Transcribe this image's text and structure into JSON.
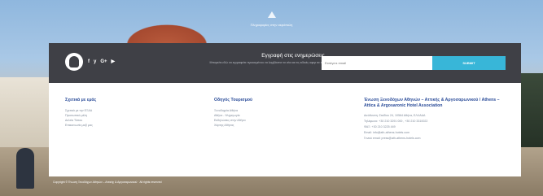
{
  "top_notice": "Πληροφορίες στην ακρόπολη",
  "subscribe": {
    "title": "Εγγραφή στις ενημερώσεις",
    "text": "Μπορείτε εδώ να εγγραφείτε προκειμένου να λαμβάνετε τα νέα και τις ειδικές οφερ σε email",
    "email_placeholder": "Εισάγετε email",
    "submit_label": "SUBMIT",
    "social": [
      "f",
      "y",
      "G+",
      "▶"
    ]
  },
  "columns": [
    {
      "title": "Σχετικά με εμάς",
      "links": [
        "Σχετικά με την ΕΞΑΑ",
        "Προσωπικό μέλη",
        "Δελτία Τύπου",
        "Επικοινωνία μαζί μας"
      ]
    },
    {
      "title": "Οδηγός Τουρισμού",
      "links": [
        "Ξενοδοχεία Αθήνα",
        "Αθήνα - Ψυχαγωγία",
        "Εκδηλώσεις στην Αθήνα",
        "Χάρτης Αθήνας"
      ]
    },
    {
      "title": "Ένωση Ξενοδόχων Αθηνών – Αττικής & Αργοσαρωνικού / Athens – Attica & Argosaronic Hotel Association",
      "lines": [
        "Διεύθυνση: Σταδίου 24, 10564 Αθήνα, ΕΛΛΑΔΑ",
        "Τηλέφωνο: +30 210 3291 000 , +30 210 3310022",
        "ΦΑΞ: +30 210 3225 449",
        "Email: info@ath-athens-hotels.com",
        "Γενικό email: press@ath-athens-hotels.com"
      ]
    }
  ],
  "footer_text": "Copyright © Ένωση Ξενοδόχων Αθηνών – Αττικής & Αργοσαρωνικού · All rights reserved"
}
